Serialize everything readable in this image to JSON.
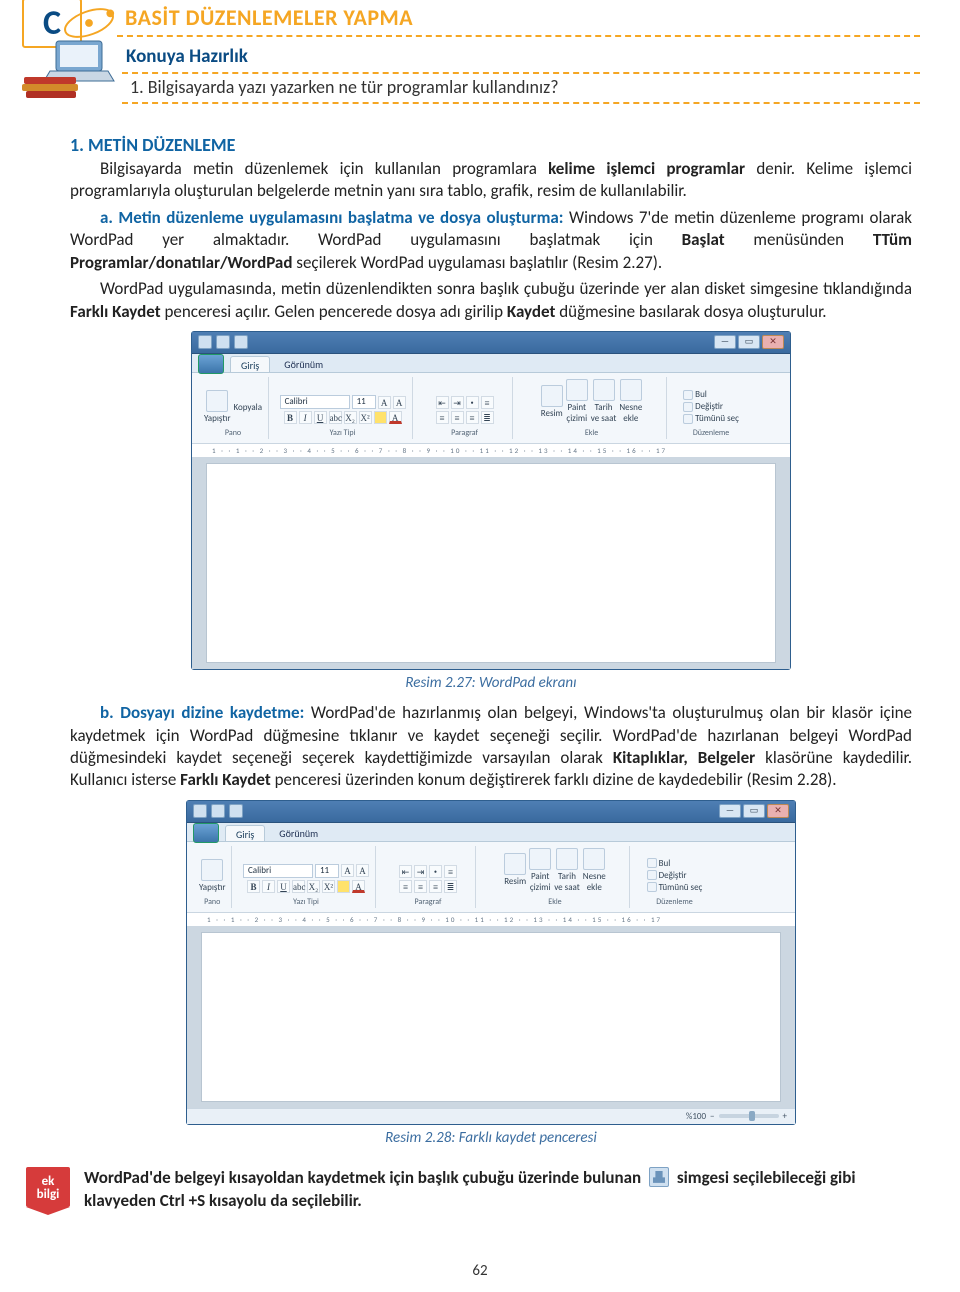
{
  "section": {
    "letter": "C",
    "title": "BASİT DÜZENLEMELER YAPMA"
  },
  "konuya": {
    "title": "Konuya Hazırlık",
    "q1": "1. Bilgisayarda yazı yazarken ne tür programlar kullandınız?"
  },
  "h1": "1. METİN DÜZENLEME",
  "p1a": "Bilgisayarda metin düzenlemek için kullanılan programlara ",
  "p1b": "kelime işlemci programlar",
  "p1c": " denir. Kelime işlemci programlarıyla oluşturulan belgelerde metnin yanı sıra tablo, grafik, resim de kullanılabilir.",
  "p2a": "a. Metin düzenleme uygulamasını başlatma ve dosya oluşturma:",
  "p2b": " Windows 7'de metin düzenleme programı olarak WordPad yer almaktadır. WordPad uygulamasını başlatmak için ",
  "p2c": "Başlat",
  "p2d": " menüsünden ",
  "p2e": "Tüm Programlar/donatılar/WordPad",
  "p2f": " seçilerek WordPad uygulaması başlatılır (Resim 2.27).",
  "p3a": "WordPad uygulamasında, metin düzenlendikten sonra başlık çubuğu üzerinde yer alan disket simgesine tıklandığında ",
  "p3b": "Farklı Kaydet",
  "p3c": " penceresi açılır. Gelen pencerede dosya adı girilip ",
  "p3d": "Kaydet",
  "p3e": " düğmesine basılarak dosya oluşturulur.",
  "fig1_caption": "Resim 2.27: WordPad ekranı",
  "p4a": "b. Dosyayı dizine kaydetme:",
  "p4b": " WordPad'de hazırlanmış olan belgeyi, Windows'ta oluşturulmuş olan bir klasör içine kaydetmek için WordPad düğmesine tıklanır ve kaydet seçeneği seçilir.  WordPad'de hazırlanan belgeyi WordPad düğmesindeki kaydet seçeneği seçerek kaydettiğimizde varsayılan olarak ",
  "p4c": "Kitaplıklar, Belgeler",
  "p4d": " klasörüne kaydedilir. Kullanıcı isterse ",
  "p4e": "Farklı Kaydet",
  "p4f": " penceresi üzerinden konum değiştirerek farklı dizine de kaydedebilir (Resim 2.28).",
  "fig2_caption": "Resim 2.28: Farklı kaydet penceresi",
  "ek": {
    "badge1": "ek",
    "badge2": "bilgi",
    "t1": "WordPad'de belgeyi kısayoldan kaydetmek için başlık çubuğu üzerinde bulunan",
    "t2": "simgesi seçilebileceği gibi klavyeden Ctrl +S kısayolu da seçilebilir."
  },
  "page_num": "62",
  "wordpad": {
    "tabs": {
      "t1": "Giriş",
      "t2": "Görünüm"
    },
    "font_name": "Calibri",
    "font_size": "11",
    "grp_pano": "Pano",
    "grp_kopyala": "Kopyala",
    "grp_yapistir": "Yapıştır",
    "grp_font": "Yazı Tipi",
    "grp_para": "Paragraf",
    "grp_ekle": "Ekle",
    "grp_duz": "Düzenleme",
    "ins_resim": "Resim",
    "ins_boya": "Paint\nçizimi",
    "ins_tarih": "Tarih\nve saat",
    "ins_nesne": "Nesne\nekle",
    "edit_bul": "Bul",
    "edit_degis": "Değiştir",
    "edit_tumu": "Tümünü seç",
    "ruler": "1 · · 1 · · 2 · · 3 · · 4 · · 5 · · 6 · · 7 · · 8 · · 9 · · 10 · · 11 · · 12 · · 13 · · 14 · · 15 · · 16 · · 17",
    "zoom": "%100",
    "sys_min": "—",
    "sys_max": "▭",
    "sys_close": "✕"
  }
}
